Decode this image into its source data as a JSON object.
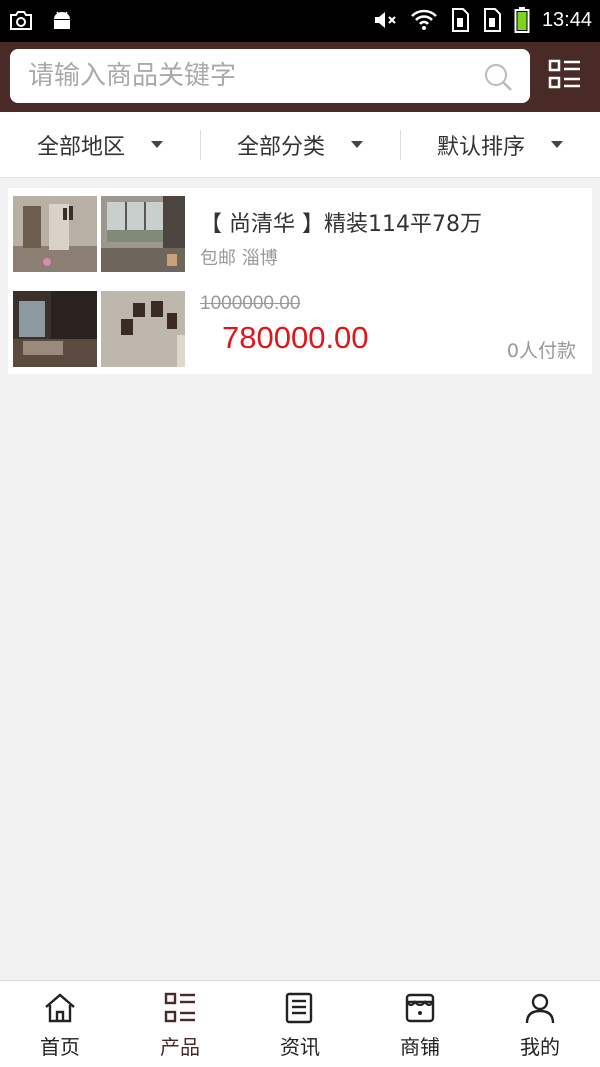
{
  "status_bar": {
    "time": "13:44",
    "icons": [
      "screenshot-icon",
      "android-icon",
      "mute-icon",
      "wifi-icon",
      "sim1-icon",
      "sim2-icon",
      "battery-icon"
    ]
  },
  "search": {
    "placeholder": "请输入商品关键字"
  },
  "filters": [
    {
      "label": "全部地区"
    },
    {
      "label": "全部分类"
    },
    {
      "label": "默认排序"
    }
  ],
  "product": {
    "title": "【 尚清华 】精装114平78万",
    "shipping": "包邮",
    "location": "淄博",
    "original_price": "1000000.00",
    "price": "780000.00",
    "buyers": "0人付款"
  },
  "bottom_nav": {
    "items": [
      {
        "label": "首页",
        "icon": "home-icon"
      },
      {
        "label": "产品",
        "icon": "product-list-icon"
      },
      {
        "label": "资讯",
        "icon": "news-icon"
      },
      {
        "label": "商铺",
        "icon": "store-icon"
      },
      {
        "label": "我的",
        "icon": "user-icon"
      }
    ],
    "active": "产品"
  },
  "colors": {
    "header_bg": "#4a2a27",
    "price_red": "#e0161b",
    "page_bg": "#f2f2f2"
  }
}
